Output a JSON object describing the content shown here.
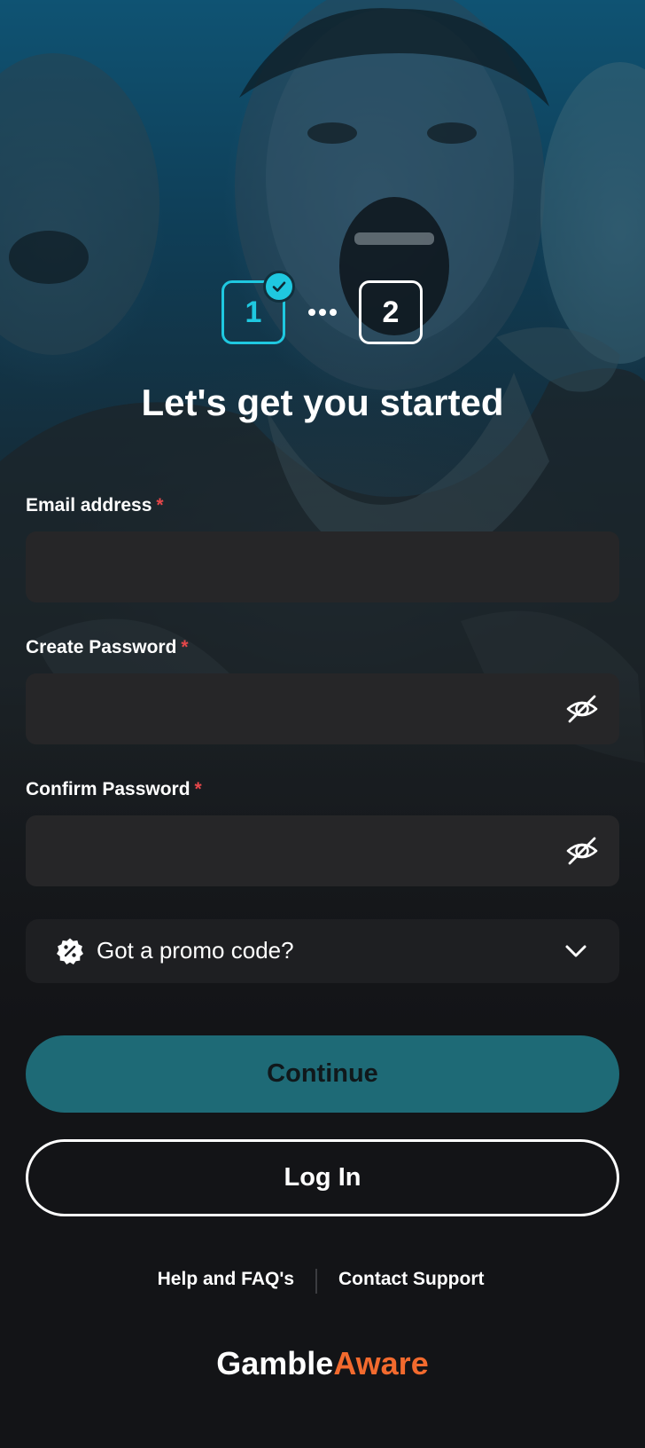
{
  "stepper": {
    "steps": [
      {
        "number": "1",
        "status": "completed"
      },
      {
        "number": "2",
        "status": "upcoming"
      }
    ]
  },
  "header": {
    "title": "Let's get you started"
  },
  "form": {
    "email": {
      "label": "Email address",
      "required_mark": "*",
      "value": "",
      "placeholder": ""
    },
    "create_password": {
      "label": "Create Password",
      "required_mark": "*",
      "value": "",
      "placeholder": "",
      "toggle_icon": "eye-off-icon"
    },
    "confirm_password": {
      "label": "Confirm Password",
      "required_mark": "*",
      "value": "",
      "placeholder": "",
      "toggle_icon": "eye-off-icon"
    }
  },
  "promo": {
    "label": "Got a promo code?",
    "icon": "discount-badge-icon",
    "expanded": false
  },
  "actions": {
    "continue_label": "Continue",
    "login_label": "Log In"
  },
  "footer": {
    "help_label": "Help and FAQ's",
    "contact_label": "Contact Support"
  },
  "brand": {
    "part1": "Gamble",
    "part2": "Aware"
  },
  "colors": {
    "accent": "#1fc8e0",
    "continue_bg": "#1e6a76",
    "required": "#e5474a",
    "brand_orange": "#f26a2e",
    "input_bg": "#262628",
    "page_bg": "#131417"
  }
}
